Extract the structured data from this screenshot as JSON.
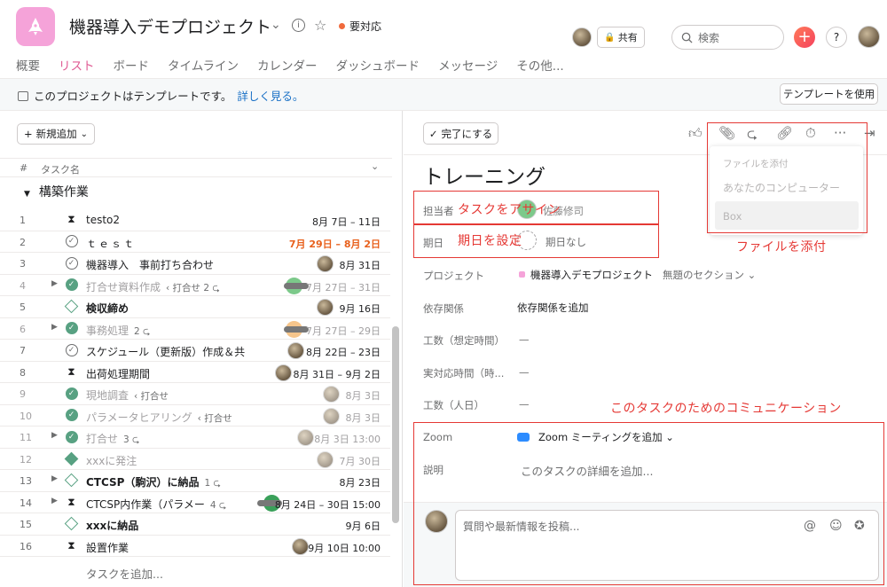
{
  "header": {
    "project_title": "機器導入デモプロジェクト",
    "status_label": "要対応",
    "share_label": "共有",
    "search_placeholder": "検索",
    "help_label": "?"
  },
  "tabs": [
    "概要",
    "リスト",
    "ボード",
    "タイムライン",
    "カレンダー",
    "ダッシュボード",
    "メッセージ",
    "その他..."
  ],
  "active_tab": "リスト",
  "banner": {
    "text": "このプロジェクトはテンプレートです。",
    "link": "詳しく見る。",
    "button": "テンプレートを使用"
  },
  "list": {
    "new_button": "新規追加",
    "col_num": "#",
    "col_task": "タスク名",
    "section": "構築作業",
    "add_task": "タスクを追加...",
    "rows": [
      {
        "num": "1",
        "name": "testo2",
        "date": "8月 7日 – 11日",
        "icon": "hourglass-icon"
      },
      {
        "num": "2",
        "name": "ｔｅｓｔ",
        "date": "7月 29日 – 8月 2日",
        "icon": "check-circle-icon"
      },
      {
        "num": "3",
        "name": "機器導入　事前打ち合わせ",
        "date": "8月 31日",
        "icon": "check-circle-icon"
      },
      {
        "num": "4",
        "name": "打合せ資料作成",
        "tag": "‹ 打合せ  2 ⮎",
        "date": "7月 27日 – 31日",
        "icon": "check-circle-filled-icon"
      },
      {
        "num": "5",
        "name": "検収締め",
        "date": "9月 16日",
        "icon": "milestone-icon"
      },
      {
        "num": "6",
        "name": "事務処理",
        "tag": "2 ⮎",
        "date": "7月 27日 – 29日",
        "icon": "check-circle-filled-icon"
      },
      {
        "num": "7",
        "name": "スケジュール（更新版）作成＆共",
        "date": "8月 22日 – 23日",
        "icon": "check-circle-icon"
      },
      {
        "num": "8",
        "name": "出荷処理期間",
        "date": "8月 31日 – 9月 2日",
        "icon": "hourglass-icon"
      },
      {
        "num": "9",
        "name": "現地調査",
        "tag": "‹ 打合せ",
        "date": "8月 3日",
        "icon": "check-circle-filled-icon"
      },
      {
        "num": "10",
        "name": "パラメータヒアリング",
        "tag": "‹ 打合せ",
        "date": "8月 3日",
        "icon": "check-circle-filled-icon"
      },
      {
        "num": "11",
        "name": "打合せ",
        "tag": "3 ⮎",
        "date": "8月 3日 13:00",
        "icon": "check-circle-filled-icon"
      },
      {
        "num": "12",
        "name": "xxxに発注",
        "date": "7月 30日",
        "icon": "milestone-filled-icon"
      },
      {
        "num": "13",
        "name": "CTCSP（駒沢）に納品",
        "tag": "1 ⮎",
        "date": "8月 23日",
        "icon": "milestone-icon"
      },
      {
        "num": "14",
        "name": "CTCSP内作業（パラメー",
        "tag": "4 ⮎",
        "date": "8月 24日 – 30日 15:00",
        "icon": "hourglass-icon"
      },
      {
        "num": "15",
        "name": "xxxに納品",
        "date": "9月 6日",
        "icon": "milestone-icon"
      },
      {
        "num": "16",
        "name": "設置作業",
        "date": "9月 10日 10:00",
        "icon": "hourglass-icon"
      }
    ]
  },
  "detail": {
    "complete_button": "完了にする",
    "title": "トレーニング",
    "assignee_label": "担当者",
    "assignee_value": "佐藤修司",
    "due_label": "期日",
    "due_value": "期日なし",
    "project_label": "プロジェクト",
    "project_value": "機器導入デモプロジェクト",
    "section_value": "無題のセクション",
    "deps_label": "依存関係",
    "deps_value": "依存関係を追加",
    "est_label": "工数（想定時間）",
    "est_value": "—",
    "actual_label": "実対応時間（時...",
    "actual_value": "—",
    "people_label": "工数（人日）",
    "people_value": "—",
    "zoom_label": "Zoom",
    "zoom_value": "Zoom ミーティングを追加",
    "desc_label": "説明",
    "desc_value": "このタスクの詳細を追加...",
    "comment_placeholder": "質問や最新情報を投稿..."
  },
  "attach_menu": {
    "title": "ファイルを添付",
    "item1": "あなたのコンピューター",
    "item2": "Box"
  },
  "annotations": {
    "assign": "タスクをアサイン",
    "due": "期日を設定",
    "attach": "ファイルを添付",
    "comm": "このタスクのためのコミュニケーション"
  },
  "colors": {
    "accent_pink": "#f5a3d9",
    "annotation_red": "#e53935",
    "complete_green": "#58a182",
    "overdue_orange": "#e8601c"
  }
}
